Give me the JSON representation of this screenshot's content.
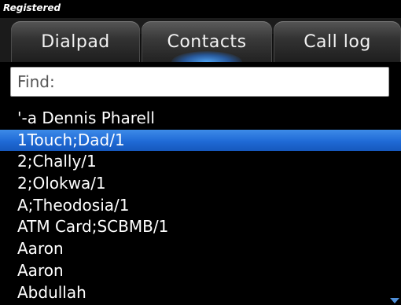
{
  "status": {
    "text": "Registered"
  },
  "tabs": [
    {
      "label": "Dialpad",
      "active": false
    },
    {
      "label": "Contacts",
      "active": true
    },
    {
      "label": "Call log",
      "active": false
    }
  ],
  "search": {
    "label": "Find:",
    "value": ""
  },
  "contacts": [
    {
      "name": "'-a Dennis Pharell"
    },
    {
      "name": "1Touch;Dad/1",
      "selected": true
    },
    {
      "name": "2;Chally/1"
    },
    {
      "name": "2;Olokwa/1"
    },
    {
      "name": "A;Theodosia/1"
    },
    {
      "name": "ATM Card;SCBMB/1"
    },
    {
      "name": "Aaron"
    },
    {
      "name": "Aaron"
    },
    {
      "name": "Abdullah"
    }
  ],
  "colors": {
    "selection": "#1f6ad6",
    "background": "#000000",
    "tab_glow": "#50aaff"
  },
  "icons": {
    "scroll_down": "chevron-down-icon"
  }
}
